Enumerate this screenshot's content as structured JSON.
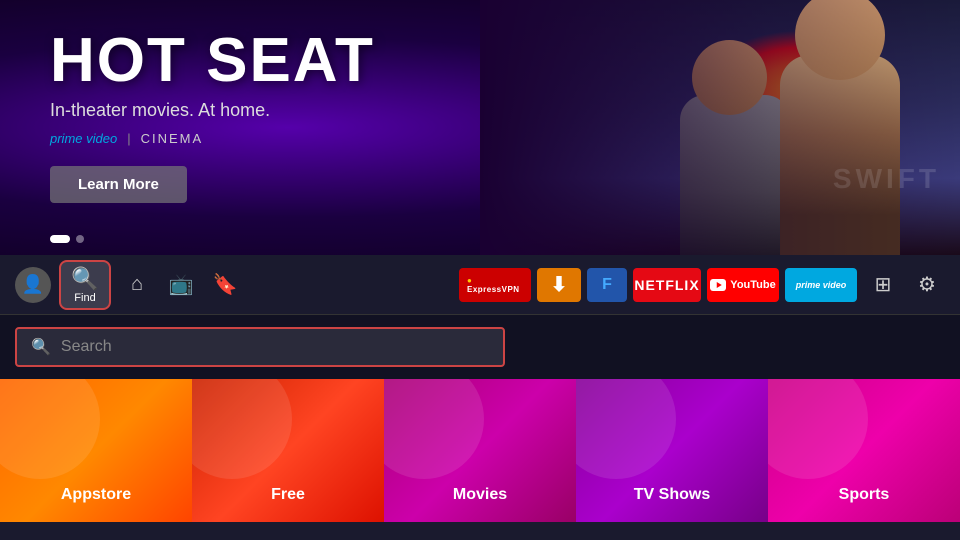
{
  "hero": {
    "title": "HOT SEAT",
    "subtitle": "In-theater movies. At home.",
    "brand_prime": "prime video",
    "brand_divider": "|",
    "brand_cinema": "CINEMA",
    "learn_more_label": "Learn More",
    "swift_watermark": "SWIFT",
    "dots": [
      {
        "active": true
      },
      {
        "active": false
      }
    ]
  },
  "nav": {
    "find_label": "Find",
    "icons": {
      "home": "⌂",
      "tv": "📺",
      "bookmark": "🔖",
      "profile": "👤",
      "settings": "⚙",
      "grid": "⊞"
    },
    "apps": [
      {
        "id": "expressvpn",
        "label": "ExpressVPN"
      },
      {
        "id": "downloader",
        "label": "↓"
      },
      {
        "id": "unknown",
        "label": "F"
      },
      {
        "id": "netflix",
        "label": "NETFLIX"
      },
      {
        "id": "youtube",
        "label": "YouTube"
      },
      {
        "id": "primevideo",
        "label": "prime video"
      }
    ]
  },
  "search": {
    "placeholder": "Search"
  },
  "categories": [
    {
      "id": "appstore",
      "label": "Appstore"
    },
    {
      "id": "free",
      "label": "Free"
    },
    {
      "id": "movies",
      "label": "Movies"
    },
    {
      "id": "tvshows",
      "label": "TV Shows"
    },
    {
      "id": "sports",
      "label": "Sports"
    }
  ]
}
